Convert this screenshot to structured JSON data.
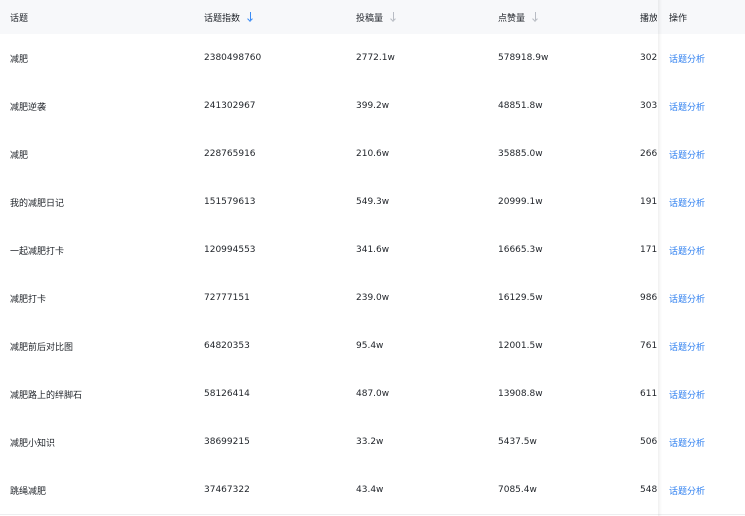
{
  "table": {
    "columns": {
      "topic": "话题",
      "index": "话题指数",
      "posts": "投稿量",
      "likes": "点赞量",
      "plays": "播放",
      "operation": "操作"
    },
    "sort_icons": {
      "index": "arrow-down-icon",
      "posts": "arrow-down-icon",
      "likes": "arrow-down-icon"
    },
    "colors": {
      "link": "#2e7ff0",
      "sort_active": "#3b8cf5",
      "sort_inactive": "#b8bcc4",
      "header_bg": "#f7f8fa"
    },
    "rows": [
      {
        "topic": "减肥",
        "index": "2380498760",
        "posts": "2772.1w",
        "likes": "578918.9w",
        "plays": "302",
        "action": "话题分析"
      },
      {
        "topic": "减肥逆袭",
        "index": "241302967",
        "posts": "399.2w",
        "likes": "48851.8w",
        "plays": "303",
        "action": "话题分析"
      },
      {
        "topic": "减肥",
        "index": "228765916",
        "posts": "210.6w",
        "likes": "35885.0w",
        "plays": "266",
        "action": "话题分析"
      },
      {
        "topic": "我的减肥日记",
        "index": "151579613",
        "posts": "549.3w",
        "likes": "20999.1w",
        "plays": "191",
        "action": "话题分析"
      },
      {
        "topic": "一起减肥打卡",
        "index": "120994553",
        "posts": "341.6w",
        "likes": "16665.3w",
        "plays": "171",
        "action": "话题分析"
      },
      {
        "topic": "减肥打卡",
        "index": "72777151",
        "posts": "239.0w",
        "likes": "16129.5w",
        "plays": "986",
        "action": "话题分析"
      },
      {
        "topic": "减肥前后对比图",
        "index": "64820353",
        "posts": "95.4w",
        "likes": "12001.5w",
        "plays": "761",
        "action": "话题分析"
      },
      {
        "topic": "减肥路上的绊脚石",
        "index": "58126414",
        "posts": "487.0w",
        "likes": "13908.8w",
        "plays": "611",
        "action": "话题分析"
      },
      {
        "topic": "减肥小知识",
        "index": "38699215",
        "posts": "33.2w",
        "likes": "5437.5w",
        "plays": "506",
        "action": "话题分析"
      },
      {
        "topic": "跳绳减肥",
        "index": "37467322",
        "posts": "43.4w",
        "likes": "7085.4w",
        "plays": "548",
        "action": "话题分析"
      }
    ]
  }
}
